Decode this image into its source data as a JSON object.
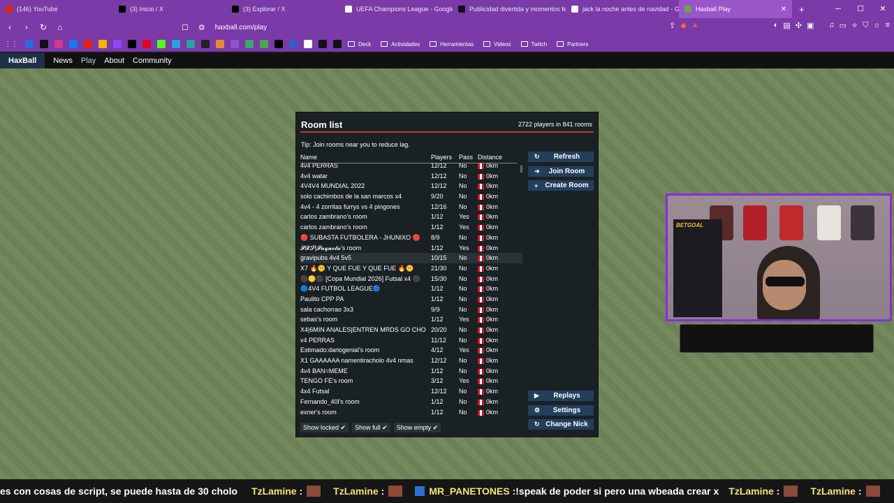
{
  "browser": {
    "tabs": [
      {
        "label": "(146) YouTube",
        "icon": "youtube-icon",
        "color": "#e62117"
      },
      {
        "label": "(3) Inicio / X",
        "icon": "x-icon",
        "color": "#000000"
      },
      {
        "label": "(3) Explorar / X",
        "icon": "x-icon",
        "color": "#000000"
      },
      {
        "label": "UEFA Champions League - Google S",
        "icon": "google-icon",
        "color": "#ffffff"
      },
      {
        "label": "Publicidad divertida y momentos fel",
        "icon": "tiktok-icon",
        "color": "#111111"
      },
      {
        "label": "jack la noche antes de navidad - Go",
        "icon": "google-icon",
        "color": "#ffffff"
      },
      {
        "label": "Haxball Play",
        "icon": "haxball-icon",
        "color": "#6da34d"
      }
    ],
    "url": "haxball.com/play",
    "bookmarks": [
      "Deck",
      "Actividades",
      "Herramientas",
      "Videos",
      "Twitch",
      "Partners"
    ]
  },
  "site_nav": {
    "logo": "HaxBall",
    "links": [
      "News",
      "Play",
      "About",
      "Community"
    ]
  },
  "room_list": {
    "title": "Room list",
    "count": "2722 players in 841 rooms",
    "tip": "Tip: Join rooms near you to reduce lag.",
    "headers": {
      "name": "Name",
      "players": "Players",
      "pass": "Pass",
      "distance": "Distance"
    },
    "rows": [
      {
        "name": "4v4 PERRAS",
        "players": "12/12",
        "pass": "No",
        "distance": "0km"
      },
      {
        "name": "4v4 watar",
        "players": "12/12",
        "pass": "No",
        "distance": "0km"
      },
      {
        "name": "4V4V4 MUNDIAL 2022",
        "players": "12/12",
        "pass": "No",
        "distance": "0km"
      },
      {
        "name": "solo cachimbos de la san marcos x4",
        "players": "9/20",
        "pass": "No",
        "distance": "0km"
      },
      {
        "name": "4v4 - 4 zorritas furrys vs 4 pingones",
        "players": "12/16",
        "pass": "No",
        "distance": "0km"
      },
      {
        "name": "carlos zambrano's room",
        "players": "1/12",
        "pass": "Yes",
        "distance": "0km"
      },
      {
        "name": "carlos zambrano's room",
        "players": "1/12",
        "pass": "Yes",
        "distance": "0km"
      },
      {
        "name": "🔴 SUBASTA FUTBOLERA - JHUNIXO 🔴",
        "players": "8/9",
        "pass": "No",
        "distance": "0km"
      },
      {
        "name": "𝓟𝓧𝓢|𝓟𝓪𝓺𝓾𝓮𝓽𝓪's room",
        "players": "1/12",
        "pass": "Yes",
        "distance": "0km"
      },
      {
        "name": "gravipubs 4v4 5v5",
        "players": "10/15",
        "pass": "No",
        "distance": "0km"
      },
      {
        "name": "X7 🔥🤫 Y QUE FUE Y QUE FUE 🔥🤫",
        "players": "21/30",
        "pass": "No",
        "distance": "0km"
      },
      {
        "name": "⚫🟡⚫ [Copa Mundial 2026] Futsal x4 ⚫",
        "players": "15/30",
        "pass": "No",
        "distance": "0km"
      },
      {
        "name": "🔵4V4 FUTBOL LEAGUE🔵",
        "players": "1/12",
        "pass": "No",
        "distance": "0km"
      },
      {
        "name": "Paulito CPP PA",
        "players": "1/12",
        "pass": "No",
        "distance": "0km"
      },
      {
        "name": "sala cachorrao 3x3",
        "players": "9/9",
        "pass": "No",
        "distance": "0km"
      },
      {
        "name": "sebas's room",
        "players": "1/12",
        "pass": "Yes",
        "distance": "0km"
      },
      {
        "name": "X4|6MIN ANALES|ENTREN MRDS GO CHO",
        "players": "20/20",
        "pass": "No",
        "distance": "0km"
      },
      {
        "name": "v4 PERRAS",
        "players": "11/12",
        "pass": "No",
        "distance": "0km"
      },
      {
        "name": "Estimado:dariogenial's room",
        "players": "4/12",
        "pass": "Yes",
        "distance": "0km"
      },
      {
        "name": "X1 GAAAAAA namentiracholo 4v4 nmas",
        "players": "12/12",
        "pass": "No",
        "distance": "0km"
      },
      {
        "name": "4v4 BAN=MEME",
        "players": "1/12",
        "pass": "No",
        "distance": "0km"
      },
      {
        "name": "TENGO FE's room",
        "players": "3/12",
        "pass": "Yes",
        "distance": "0km"
      },
      {
        "name": "4x4 Futsal",
        "players": "12/12",
        "pass": "No",
        "distance": "0km"
      },
      {
        "name": "Fernando_40l's room",
        "players": "1/12",
        "pass": "No",
        "distance": "0km"
      },
      {
        "name": "exner's room",
        "players": "1/12",
        "pass": "No",
        "distance": "0km"
      }
    ],
    "buttons": {
      "refresh": "Refresh",
      "join": "Join Room",
      "create": "Create Room",
      "replays": "Replays",
      "settings": "Settings",
      "change_nick": "Change Nick"
    },
    "toggles": {
      "show_locked": "Show locked",
      "show_full": "Show full",
      "show_empty": "Show empty"
    }
  },
  "stream_overlay": {
    "webcam_brand": "BETGOAL",
    "ticker": {
      "lead": "es con cosas de script, se puede hasta de 30 cholo",
      "names": [
        "TzLamine",
        "TzLamine"
      ],
      "highlight_name": "MR_PANETONES",
      "highlight_msg": ":!speak de poder si pero una wbeada crear x",
      "tail_names": [
        "TzLamine",
        "TzLamine"
      ]
    }
  },
  "colors": {
    "browser_purple": "#7a3aa8",
    "field_green": "#6f8559",
    "dialog_bg": "#1a2125",
    "button_blue": "#233f5c",
    "accent_red": "#c13535",
    "webcam_border": "#8a2be2"
  }
}
